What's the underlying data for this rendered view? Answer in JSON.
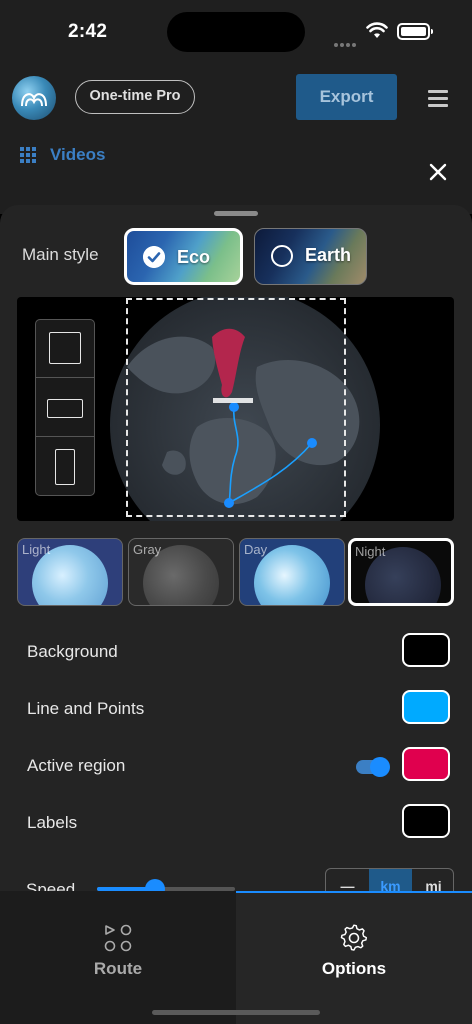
{
  "status_bar": {
    "time": "2:42"
  },
  "header": {
    "pro_label": "One-time Pro",
    "export_label": "Export",
    "videos_label": "Videos"
  },
  "sheet": {
    "main_style_label": "Main style",
    "styles": [
      {
        "label": "Eco",
        "selected": true
      },
      {
        "label": "Earth",
        "selected": false
      }
    ],
    "themes": [
      {
        "label": "Light",
        "selected": false
      },
      {
        "label": "Gray",
        "selected": false
      },
      {
        "label": "Day",
        "selected": false
      },
      {
        "label": "Night",
        "selected": true
      }
    ],
    "settings": {
      "background_label": "Background",
      "background_color": "#000000",
      "line_points_label": "Line and Points",
      "line_points_color": "#00aaff",
      "active_region_label": "Active region",
      "active_region_enabled": true,
      "active_region_color": "#e0004e",
      "labels_label": "Labels",
      "labels_color": "#000000"
    },
    "speed": {
      "label": "Speed",
      "value_fraction": 0.42,
      "units": [
        "—",
        "km",
        "mi"
      ],
      "selected_unit": "km"
    }
  },
  "tabs": [
    {
      "label": "Route",
      "icon": "route-icon",
      "active": false
    },
    {
      "label": "Options",
      "icon": "gear-icon",
      "active": true
    }
  ],
  "colors": {
    "accent": "#1a8cff",
    "export_bg": "#1f5a8a",
    "sheet_bg": "#242424"
  }
}
